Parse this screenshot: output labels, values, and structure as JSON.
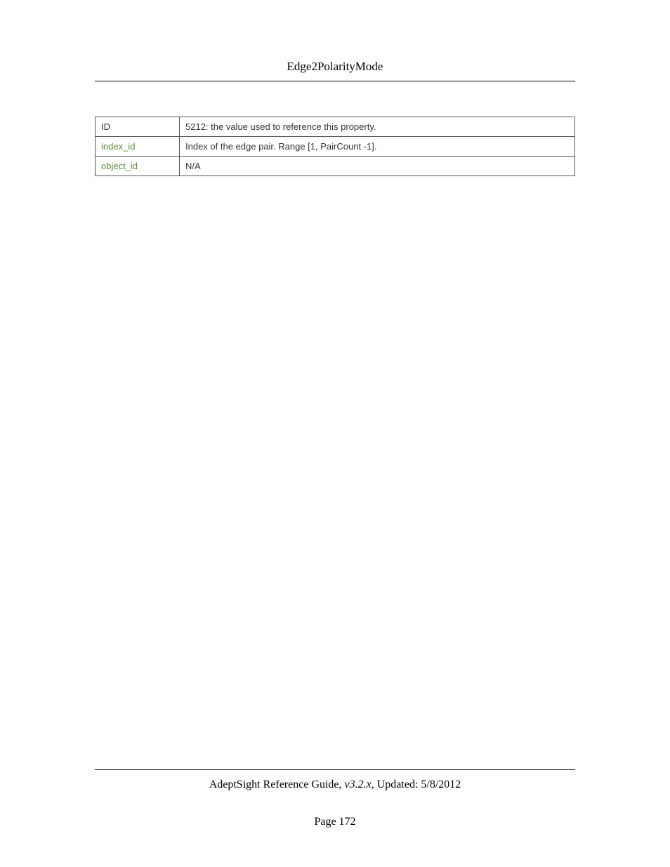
{
  "header": {
    "title": "Edge2PolarityMode"
  },
  "table": {
    "rows": [
      {
        "label": "ID",
        "labelIsLink": false,
        "value": "5212: the value used to reference this property."
      },
      {
        "label": "index_id",
        "labelIsLink": true,
        "value": "Index of the edge pair. Range [1, PairCount -1]."
      },
      {
        "label": "object_id",
        "labelIsLink": true,
        "value": "N/A"
      }
    ]
  },
  "footer": {
    "guideTitle": "AdeptSight Reference Guide",
    "version": ", v3.2.x",
    "updatedPrefix": ", Updated: ",
    "updatedDate": "5/8/2012",
    "pagePrefix": "Page ",
    "pageNumber": "172"
  }
}
